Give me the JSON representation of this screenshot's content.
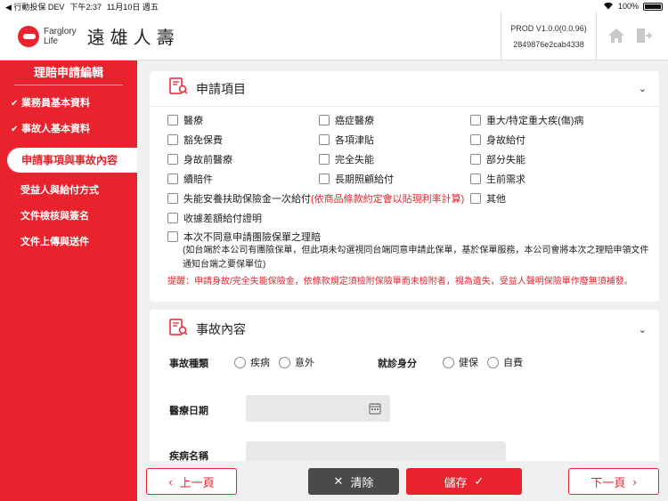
{
  "status_bar": {
    "back_label": "◀ 行動投保 DEV",
    "time": "下午2:37",
    "date": "11月10日 週五",
    "battery": "100%"
  },
  "header": {
    "logo_text_1": "Farglory",
    "logo_text_2": "Life",
    "brand": "遠雄人壽",
    "version": "PROD V1.0.0(0.0.96)",
    "build_hash": "2849876e2cab4338",
    "home_icon": "home-icon",
    "logout_icon": "logout-icon"
  },
  "sidebar": {
    "title": "理賠申請編輯",
    "items": [
      {
        "label": "業務員基本資料",
        "checked": true
      },
      {
        "label": "事故人基本資料",
        "checked": true
      },
      {
        "label": "申請事項與事故內容",
        "active": true
      },
      {
        "label": "受益人與給付方式"
      },
      {
        "label": "文件檢核與簽名"
      },
      {
        "label": "文件上傳與送件"
      }
    ]
  },
  "apply_section": {
    "title": "申請項目",
    "items": [
      {
        "label": "醫療"
      },
      {
        "label": "癌症醫療"
      },
      {
        "label": "重大/特定重大疾(傷)病"
      },
      {
        "label": "豁免保費"
      },
      {
        "label": "各項津貼"
      },
      {
        "label": "身故給付"
      },
      {
        "label": "身故前醫療"
      },
      {
        "label": "完全失能"
      },
      {
        "label": "部分失能"
      },
      {
        "label": "續賠件"
      },
      {
        "label": "長期照顧給付"
      },
      {
        "label": "生前需求"
      }
    ],
    "disability_lump_sum": "失能安養扶助保險金一次給付",
    "disability_note": "(依商品條款約定會以貼現利率計算)",
    "other": "其他",
    "receipt_diff": "收據差額給付證明",
    "group_disagree": "本次不同意申請團險保單之理賠",
    "group_note": "(如台端於本公司有團險保單，但此項未勾選視同台端同意申請此保單，基於保單服務，本公司會將本次之理賠申領文件通知台端之要保單位)",
    "reminder": "提醒：申請身故/完全失能保險金，依條款規定須檢附保險單而未檢附者，視為遺失，受益人聲明保險單作廢無須補發。"
  },
  "accident_section": {
    "title": "事故內容",
    "accident_type_label": "事故種類",
    "accident_types": [
      "疾病",
      "意外"
    ],
    "visit_status_label": "就診身分",
    "visit_status": [
      "健保",
      "自費"
    ],
    "medical_date_label": "醫療日期",
    "disease_name_label": "疾病名稱"
  },
  "footer": {
    "prev": "上一頁",
    "clear": "清除",
    "save": "儲存",
    "next": "下一頁"
  }
}
